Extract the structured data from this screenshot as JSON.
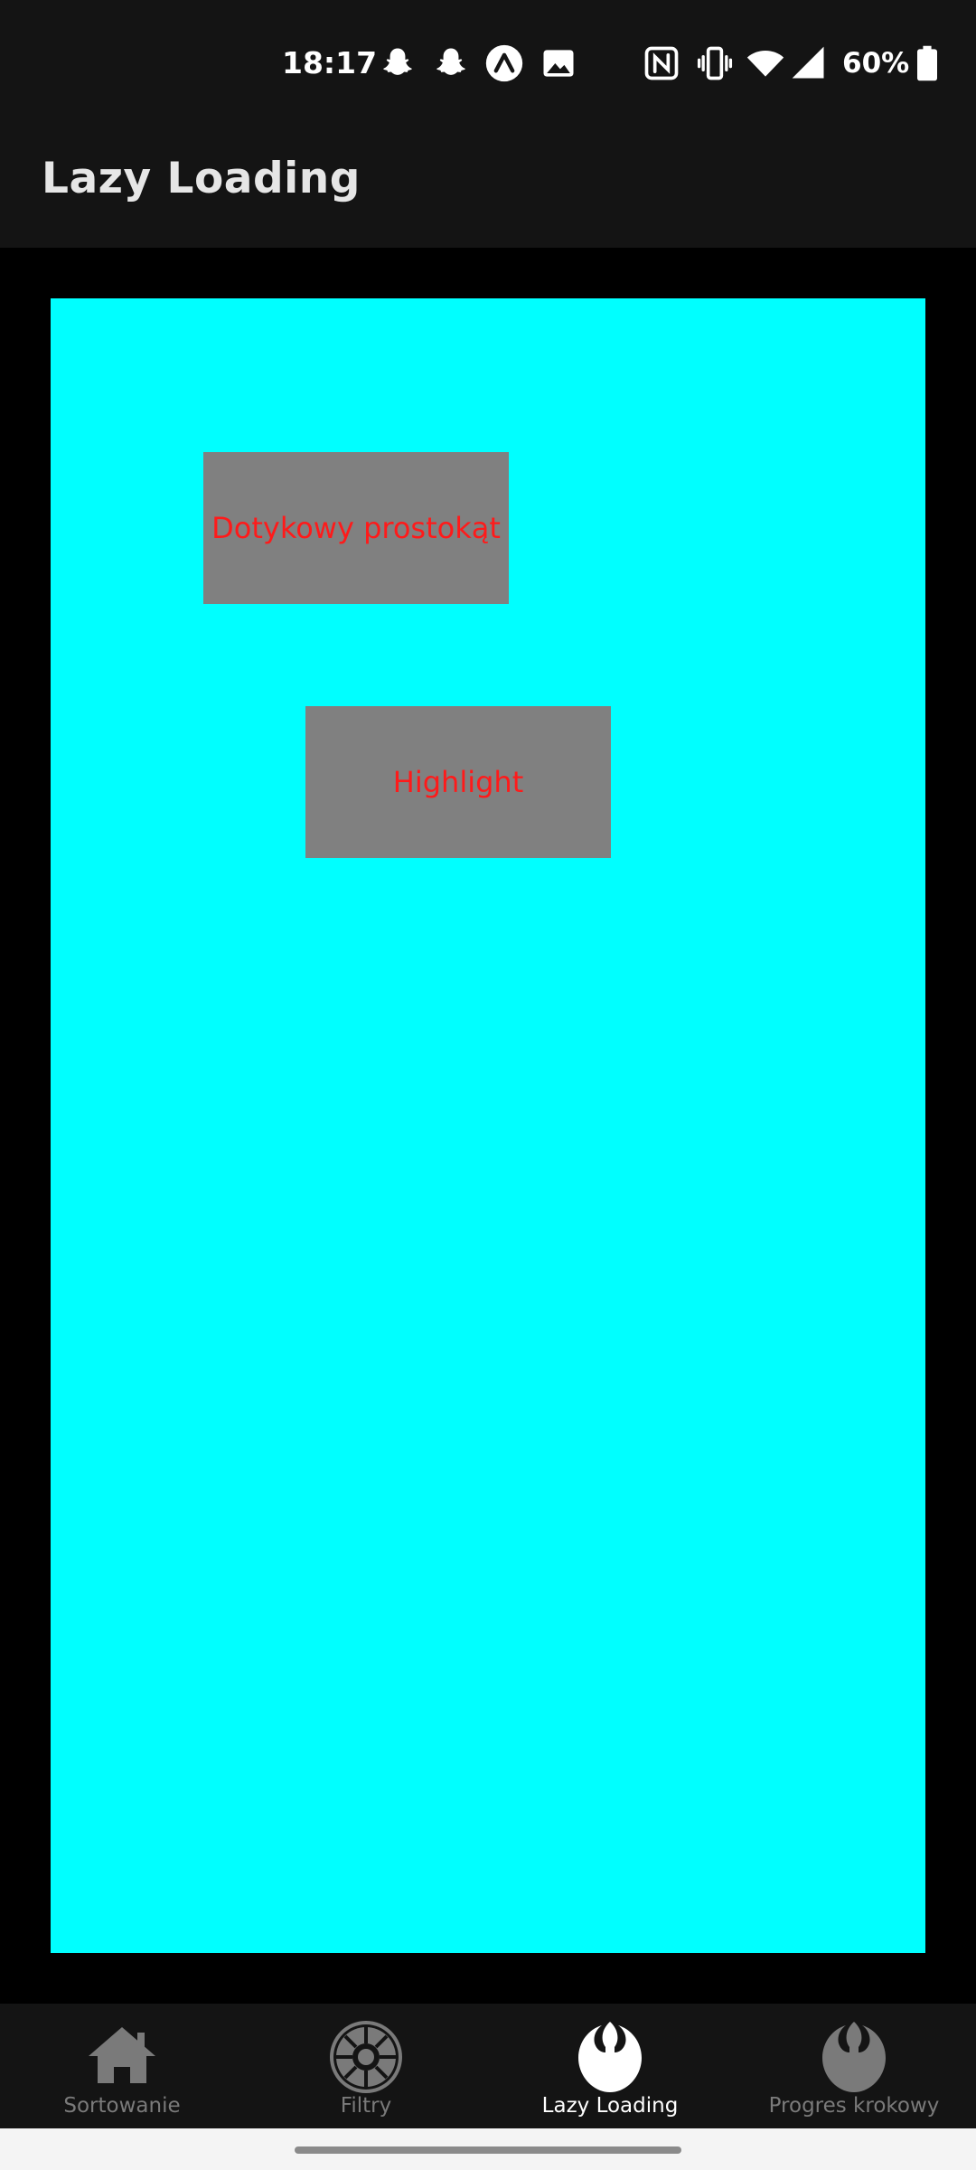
{
  "status_bar": {
    "time": "18:17",
    "battery_text": "60%",
    "icons": [
      "snapchat-icon",
      "snapchat-icon",
      "expo-icon",
      "image-icon",
      "nfc-icon",
      "vibrate-icon",
      "wifi-icon",
      "signal-icon",
      "battery-icon"
    ]
  },
  "app_bar": {
    "title": "Lazy Loading"
  },
  "main": {
    "panel_color": "#00ffff",
    "touch_box_label": "Dotykowy prostokąt",
    "highlight_box_label": "Highlight",
    "box_color": "#808080",
    "box_text_color": "#ff1a1a"
  },
  "bottom_nav": {
    "items": [
      {
        "label": "Sortowanie",
        "icon": "home-icon",
        "active": false
      },
      {
        "label": "Filtry",
        "icon": "galactic-empire-icon",
        "active": false
      },
      {
        "label": "Lazy Loading",
        "icon": "rebel-alliance-icon",
        "active": true
      },
      {
        "label": "Progres krokowy",
        "icon": "rebel-alliance-icon",
        "active": false
      }
    ]
  }
}
